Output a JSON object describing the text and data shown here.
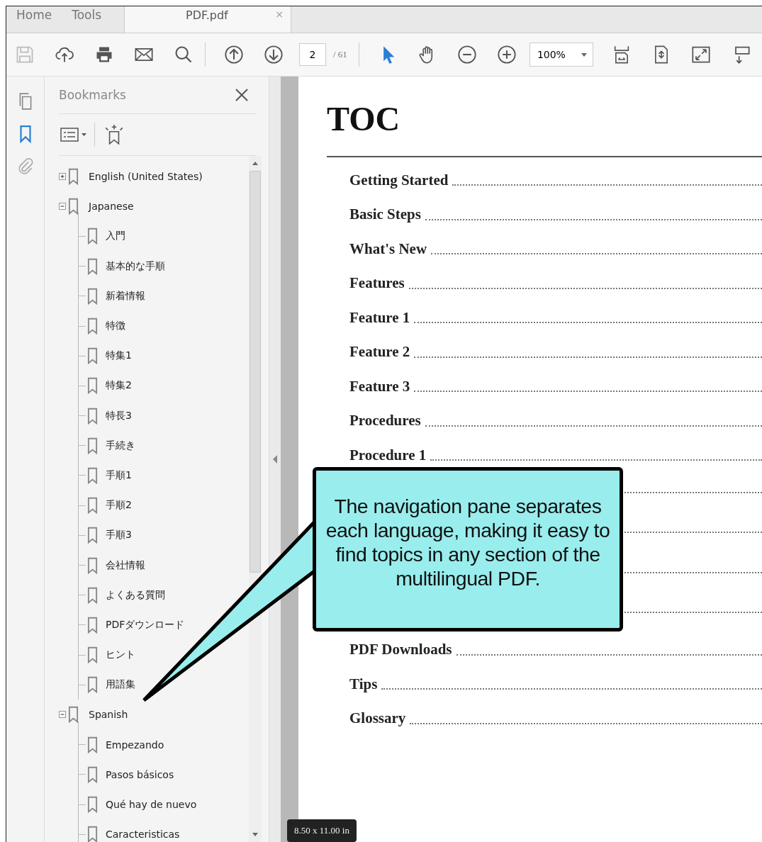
{
  "tabs": [
    {
      "label": "Home",
      "selected": false,
      "kind": "nav"
    },
    {
      "label": "Tools",
      "selected": false,
      "kind": "nav"
    },
    {
      "label": "PDF.pdf",
      "selected": true,
      "kind": "document",
      "close": "×"
    }
  ],
  "toolbar": {
    "page_number": "2",
    "page_total": "/ 61",
    "zoom": "100%"
  },
  "bookmarks": {
    "title": "Bookmarks",
    "items": [
      {
        "label": "English (United States)",
        "expanded": false
      },
      {
        "label": "Japanese",
        "expanded": true,
        "children": [
          {
            "label": "入門"
          },
          {
            "label": "基本的な手順"
          },
          {
            "label": "新着情報"
          },
          {
            "label": "特徴"
          },
          {
            "label": "特集1"
          },
          {
            "label": "特集2"
          },
          {
            "label": "特長3"
          },
          {
            "label": "手続き"
          },
          {
            "label": "手順1"
          },
          {
            "label": "手順2"
          },
          {
            "label": "手順3"
          },
          {
            "label": "会社情報"
          },
          {
            "label": "よくある質問"
          },
          {
            "label": "PDFダウンロード"
          },
          {
            "label": "ヒント"
          },
          {
            "label": "用語集"
          }
        ]
      },
      {
        "label": "Spanish",
        "expanded": true,
        "children": [
          {
            "label": "Empezando"
          },
          {
            "label": "Pasos básicos"
          },
          {
            "label": "Qué hay de nuevo"
          },
          {
            "label": "Caracteristicas"
          }
        ]
      }
    ]
  },
  "page": {
    "heading": "TOC",
    "toc": [
      {
        "kind": "entry",
        "title": "Getting Started"
      },
      {
        "kind": "entry",
        "title": "Basic Steps"
      },
      {
        "kind": "entry",
        "title": "What's New"
      },
      {
        "kind": "entry",
        "title": "Features"
      },
      {
        "kind": "entry",
        "title": "Feature 1"
      },
      {
        "kind": "entry",
        "title": "Feature 2"
      },
      {
        "kind": "entry",
        "title": "Feature 3"
      },
      {
        "kind": "entry",
        "title": "Procedures"
      },
      {
        "kind": "entry",
        "title": "Procedure 1"
      },
      {
        "kind": "callout",
        "text": "The navigation pane separates each language, making it easy to find topics in any section of the multilingual PDF."
      },
      {
        "kind": "entry",
        "title": "PDF Downloads"
      },
      {
        "kind": "entry",
        "title": "Tips"
      },
      {
        "kind": "entry",
        "title": "Glossary"
      }
    ]
  },
  "page_size": "8.50 x 11.00 in"
}
